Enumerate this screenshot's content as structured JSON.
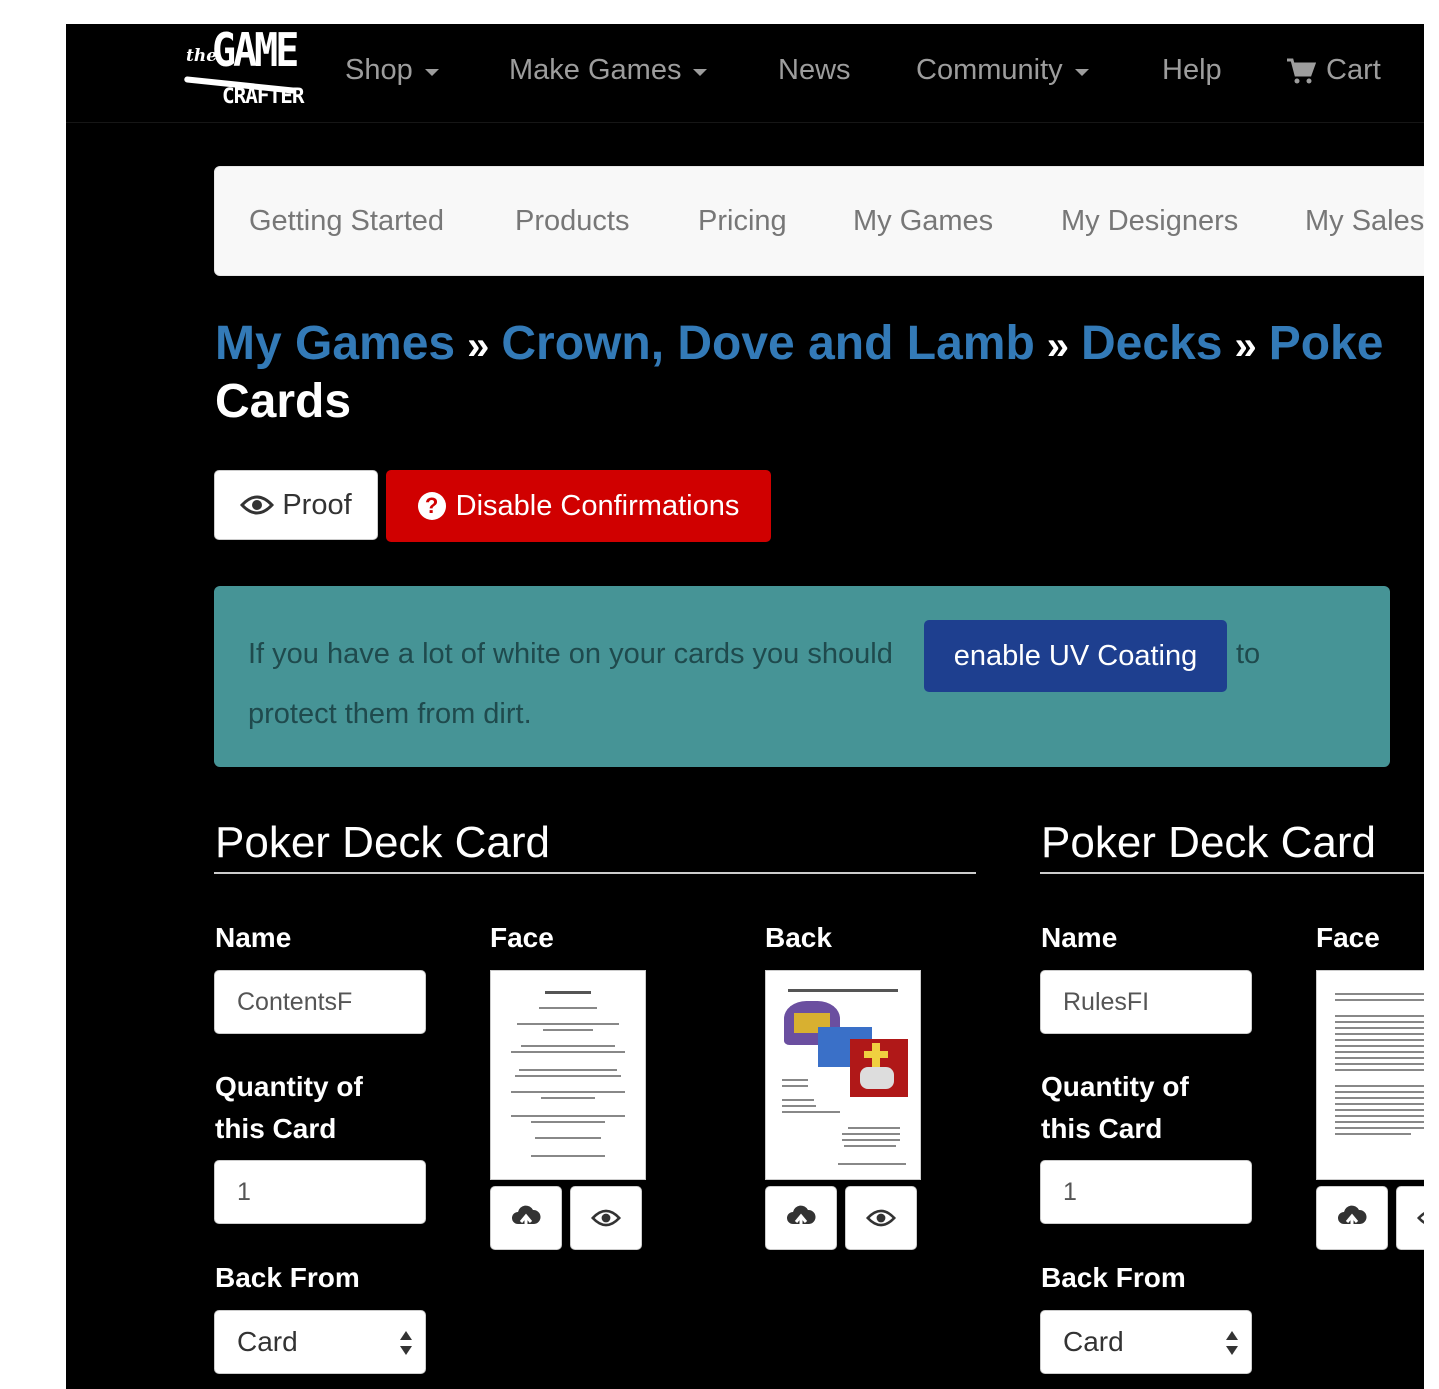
{
  "nav": {
    "logo": {
      "the": "the",
      "game": "GAME",
      "crafter": "CRAFTER"
    },
    "items": [
      {
        "label": "Shop",
        "dropdown": true
      },
      {
        "label": "Make Games",
        "dropdown": true
      },
      {
        "label": "News",
        "dropdown": false
      },
      {
        "label": "Community",
        "dropdown": true
      },
      {
        "label": "Help",
        "dropdown": false
      }
    ],
    "cart": "Cart"
  },
  "subnav": {
    "items": [
      "Getting Started",
      "Products",
      "Pricing",
      "My Games",
      "My Designers",
      "My Sales"
    ]
  },
  "breadcrumb": {
    "links": [
      "My Games",
      "Crown, Dove and Lamb",
      "Decks",
      "Poke"
    ],
    "separator": "»",
    "current": "Cards"
  },
  "actions": {
    "proof": "Proof",
    "disable_confirmations": "Disable Confirmations"
  },
  "alert": {
    "text_before": "If you have a lot of white on your cards you should",
    "button": "enable UV Coating",
    "text_after": "to",
    "text_line2": "protect them from dirt."
  },
  "cards": [
    {
      "section_title": "Poker Deck Card",
      "name_label": "Name",
      "name_value": "ContentsF",
      "quantity_label_1": "Quantity of",
      "quantity_label_2": "this Card",
      "quantity_value": "1",
      "back_from_label": "Back From",
      "back_from_value": "Card",
      "face_label": "Face",
      "back_label": "Back"
    },
    {
      "section_title": "Poker Deck Card",
      "name_label": "Name",
      "name_value": "RulesFI",
      "quantity_label_1": "Quantity of",
      "quantity_label_2": "this Card",
      "quantity_value": "1",
      "back_from_label": "Back From",
      "back_from_value": "Card",
      "face_label": "Face"
    }
  ],
  "colors": {
    "link": "#337ab7",
    "danger": "#d00000",
    "alert_bg": "#469496",
    "uv_button": "#1e3f8f"
  }
}
